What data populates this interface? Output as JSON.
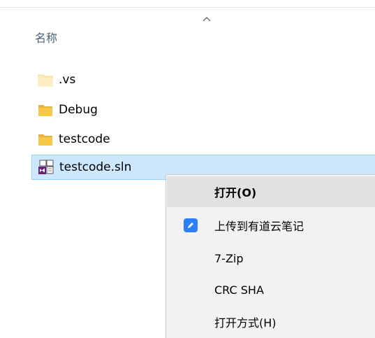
{
  "header": {
    "column_name": "名称"
  },
  "files": [
    {
      "name": ".vs",
      "icon": "folder-hidden-icon"
    },
    {
      "name": "Debug",
      "icon": "folder-icon"
    },
    {
      "name": "testcode",
      "icon": "folder-icon"
    },
    {
      "name": "testcode.sln",
      "icon": "visual-studio-solution-icon"
    }
  ],
  "context_menu": {
    "items": [
      {
        "label": "打开(O)"
      },
      {
        "label": "上传到有道云笔记",
        "icon": "youdao-note-icon"
      },
      {
        "label": "7-Zip"
      },
      {
        "label": "CRC SHA"
      },
      {
        "label": "打开方式(H)"
      }
    ]
  },
  "colors": {
    "selection_bg": "#cce8ff",
    "selection_border": "#99d1ff",
    "folder": "#f6c94a",
    "youdao_blue": "#2d7ff9",
    "menu_bg": "#f2f2f2",
    "menu_hover": "#e1e1e1"
  }
}
